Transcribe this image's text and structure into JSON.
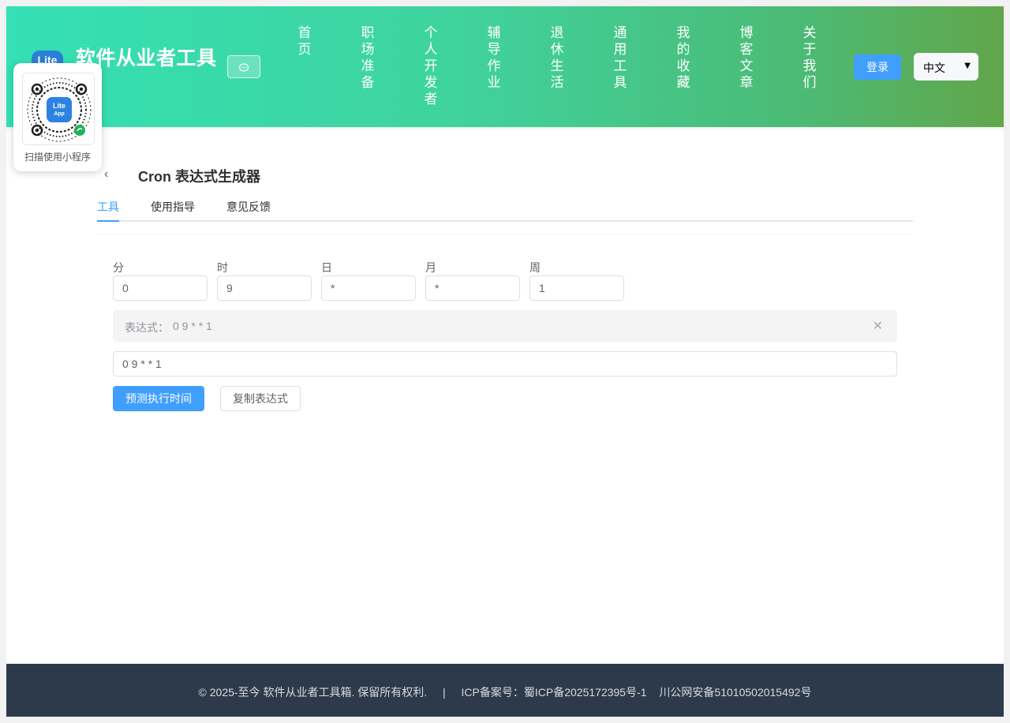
{
  "header": {
    "logo_text": "Lite",
    "site_title": "软件从业者工具",
    "chat_icon": "chat-bubble-icon",
    "nav_items": [
      "首页",
      "职场准备",
      "个人开发者",
      "辅导作业",
      "退休生活",
      "通用工具",
      "我的收藏",
      "博客文章",
      "关于我们"
    ],
    "login_label": "登录",
    "language_selected": "中文"
  },
  "qr_card": {
    "caption": "扫描使用小程序",
    "center_text_1": "Lite",
    "center_text_2": "App"
  },
  "tool": {
    "back_icon": "chevron-left-icon",
    "title": "Cron 表达式生成器",
    "tabs": [
      "工具",
      "使用指导",
      "意见反馈"
    ],
    "active_tab": "工具",
    "fields": [
      {
        "label": "分",
        "value": "0"
      },
      {
        "label": "时",
        "value": "9"
      },
      {
        "label": "日",
        "value": "*"
      },
      {
        "label": "月",
        "value": "*"
      },
      {
        "label": "周",
        "value": "1"
      }
    ],
    "alert_label": "表达式：",
    "alert_value": "0 9 * * 1",
    "expression_value": "0 9 * * 1",
    "preview_button": "预测执行时间",
    "copy_button": "复制表达式"
  },
  "footer": {
    "copyright": "© 2025-至今 软件从业者工具箱. 保留所有权利.",
    "separator": "|",
    "icp": "ICP备案号：蜀ICP备2025172395号-1",
    "police": "川公网安备51010502015492号"
  },
  "colors": {
    "primary": "#409eff",
    "header_gradient_start": "#34e0b4",
    "header_gradient_end": "#62a64a",
    "footer_bg": "#2d3a4b"
  }
}
